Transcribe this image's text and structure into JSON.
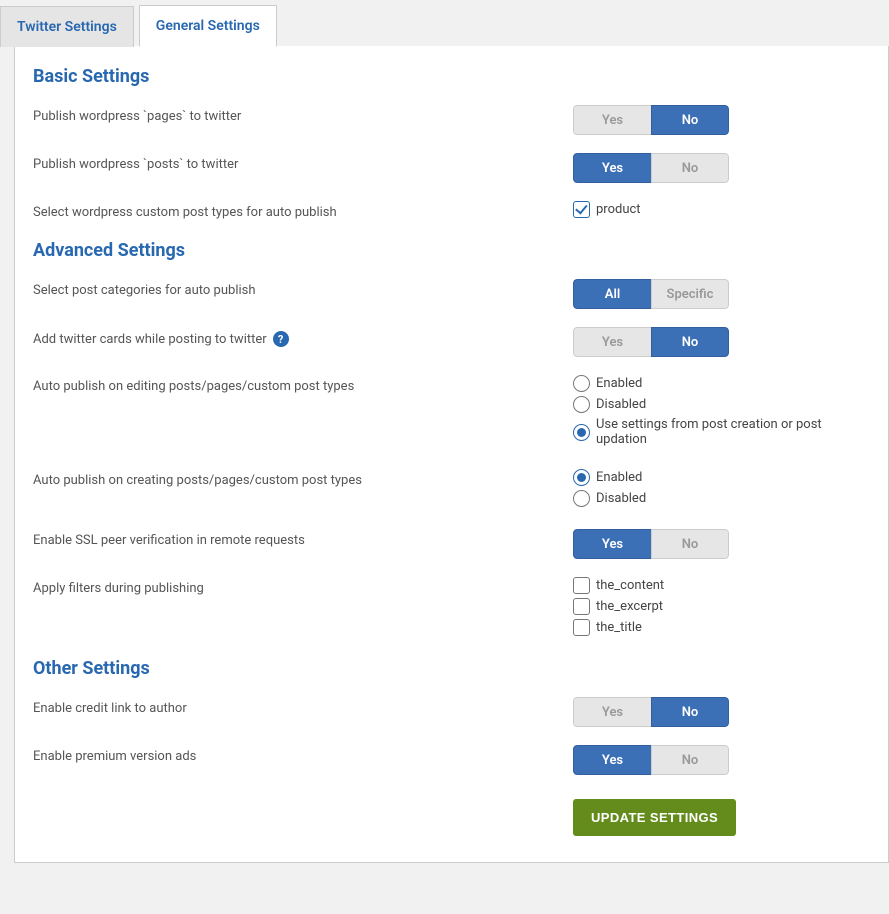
{
  "tabs": {
    "twitter": "Twitter Settings",
    "general": "General Settings"
  },
  "labels": {
    "yes": "Yes",
    "no": "No",
    "all": "All",
    "specific": "Specific"
  },
  "sections": {
    "basic": {
      "title": "Basic Settings",
      "publish_pages_label": "Publish wordpress `pages` to twitter",
      "publish_pages_value": "no",
      "publish_posts_label": "Publish wordpress `posts` to twitter",
      "publish_posts_value": "yes",
      "custom_types_label": "Select wordpress custom post types for auto publish",
      "custom_types": [
        {
          "name": "product",
          "checked": true
        }
      ]
    },
    "advanced": {
      "title": "Advanced Settings",
      "categories_label": "Select post categories for auto publish",
      "categories_value": "all",
      "twitter_cards_label": "Add twitter cards while posting to twitter",
      "twitter_cards_value": "no",
      "autopub_edit_label": "Auto publish on editing posts/pages/custom post types",
      "autopub_edit_options": {
        "enabled": "Enabled",
        "disabled": "Disabled",
        "use_settings": "Use settings from post creation or post updation"
      },
      "autopub_edit_value": "use_settings",
      "autopub_create_label": "Auto publish on creating posts/pages/custom post types",
      "autopub_create_options": {
        "enabled": "Enabled",
        "disabled": "Disabled"
      },
      "autopub_create_value": "enabled",
      "ssl_label": "Enable SSL peer verification in remote requests",
      "ssl_value": "yes",
      "filters_label": "Apply filters during publishing",
      "filters": [
        {
          "name": "the_content",
          "checked": false
        },
        {
          "name": "the_excerpt",
          "checked": false
        },
        {
          "name": "the_title",
          "checked": false
        }
      ]
    },
    "other": {
      "title": "Other Settings",
      "credit_label": "Enable credit link to author",
      "credit_value": "no",
      "premium_ads_label": "Enable premium version ads",
      "premium_ads_value": "yes"
    }
  },
  "submit_label": "UPDATE SETTINGS",
  "help_icon_text": "?"
}
